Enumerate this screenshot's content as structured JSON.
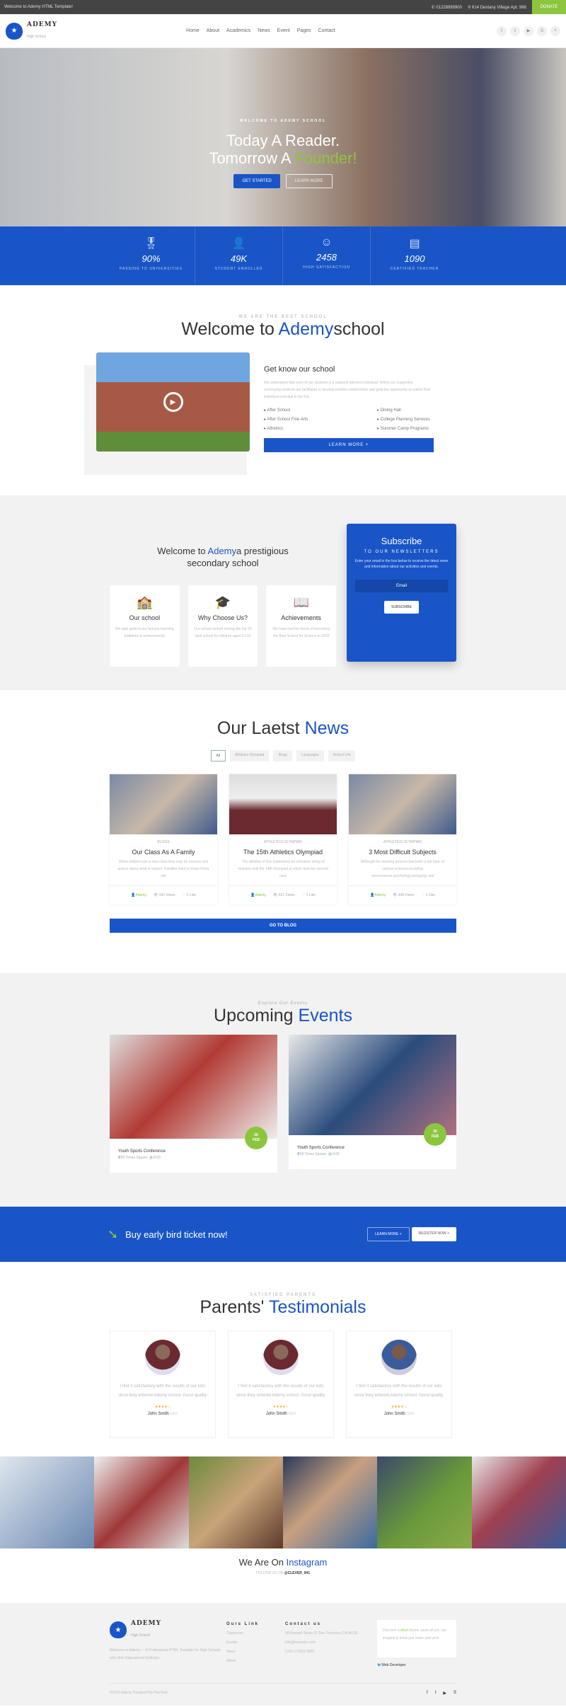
{
  "colors": {
    "primary": "#1a55c7",
    "accent": "#8cc63f",
    "topbar": "#444444"
  },
  "topbar": {
    "welcome": "Welcome to Ademy HTML Template!",
    "phone": "01228899900",
    "address": "614 Destany Village Apt. 968",
    "donate": "DONATE"
  },
  "header": {
    "brand": "ADEMY",
    "tagline": "High School",
    "nav": [
      "Home",
      "About",
      "Academics",
      "News",
      "Event",
      "Pages",
      "Contact"
    ],
    "socials": [
      "facebook-icon",
      "twitter-icon",
      "youtube-icon",
      "skype-icon",
      "search-icon"
    ]
  },
  "hero": {
    "kicker": "WELCOME TO ADEMY SCHOOL",
    "line1": "Today A Reader.",
    "line2": "Tomorrow A ",
    "highlight": "Founder!",
    "get_started": "GET STARTED",
    "learn_more": "LEARN MORE"
  },
  "stats": [
    {
      "icon": "award-icon",
      "value": "90%",
      "label": "PASSING TO UNIVERSITIES"
    },
    {
      "icon": "user-icon",
      "value": "49K",
      "label": "STUDENT ENROLLED"
    },
    {
      "icon": "smile-icon",
      "value": "2458",
      "label": "HIGH SATISFACTION"
    },
    {
      "icon": "id-card-icon",
      "value": "1090",
      "label": "CERTIFIED TEACHER"
    }
  ],
  "welcome": {
    "kicker": "WE ARE THE BEST SCHOOL",
    "title": "Welcome to ",
    "brand": "Ademy",
    "title_end": "school",
    "subtitle": "Get know our school",
    "text": "We understand that each of our students is a uniquely talented individual. Within our supportive community,students are facilitated to develop positive relationships and grab the opportunity to realize their individual potential to the full.",
    "list": [
      "After School",
      "Dining Hall",
      "After School Fine Arts",
      "College Planning Services",
      "Athletics",
      "Summer Camp Programs"
    ],
    "button": "LEARN MORE +"
  },
  "about": {
    "title_pre": "Welcome to ",
    "brand": "Ademy",
    "title_post": "a prestigious",
    "title_line2": "secondary school",
    "cards": [
      {
        "icon": "school-building-icon",
        "title": "Our school",
        "text": "We take pride in our famous teaching traditions & achievements"
      },
      {
        "icon": "graduation-cap-icon",
        "title": "Why Choose Us?",
        "text": "Our school ranked among the top 10 best school for children aged 13-19"
      },
      {
        "icon": "book-icon",
        "title": "Achievements",
        "text": "We have had the honor of becoming the Best School for Science in 2020"
      }
    ],
    "subscribe": {
      "title": "Subscribe",
      "kicker": "TO OUR NEWSLETTERS",
      "text": "Enter your email in the box below to receive the latest news and information about our activities and events.",
      "placeholder": "Email",
      "button": "SUBSCRIBE"
    }
  },
  "news": {
    "title": "Our Laetst ",
    "highlight": "News",
    "filters": [
      "All",
      "Athletics Olympiad",
      "Blogs",
      "Languages",
      "School Life"
    ],
    "items": [
      {
        "cat": "BLOGS",
        "title": "Our Class As A Family",
        "text": "When children join a new class,they may be nervous and unsure about what to expect. Families want to know if they will",
        "author": "Ademy",
        "views": "342 Views",
        "likes": "0 Like"
      },
      {
        "cat": "ATHLETICS OLYMPIAD",
        "title": "The 15th Athletics Olympiad",
        "text": "The athletes of Elis maintained an unbroken string of victories until the 14th Olympiad,at which time the second race",
        "author": "Ademy",
        "views": "321 Views",
        "likes": "2 Like"
      },
      {
        "cat": "ATHLETICS OLYMPIAD",
        "title": "3 Most Difficult Subjects",
        "text": "Although the learning process has been a hot topic of various sciences,including neuroscience,psychology,pedagogy and",
        "author": "Ademy",
        "views": "308 Views",
        "likes": "1 Like"
      }
    ],
    "button": "GO TO BLOG"
  },
  "events": {
    "kicker": "Explore Our Events",
    "title": "Upcoming ",
    "highlight": "Events",
    "items": [
      {
        "day": "26",
        "month": "FEB",
        "title": "Youth Sports Conference",
        "place": "30 Times Square",
        "time": "8:00"
      },
      {
        "day": "26",
        "month": "FEB",
        "title": "Youth Sports Conference",
        "place": "30 Times Square",
        "time": "8:00"
      }
    ]
  },
  "banner": {
    "text": "Buy early bird ticket now!",
    "learn": "LEARN MORE +",
    "register": "REGISTER NOW +"
  },
  "testimonials": {
    "kicker": "SATISFIED PARENTS",
    "title": "Parents' ",
    "highlight": "Testimonials",
    "items": [
      {
        "text": "I find it satisfactory with the results of our kids since they entered Ademy school. Good quality.",
        "rating": 4,
        "stars": "★★★★☆",
        "name": "John Smith",
        "role": "CEO"
      },
      {
        "text": "I find it satisfactory with the results of our kids since they entered Ademy school. Good quality.",
        "rating": 4,
        "stars": "★★★★☆",
        "name": "John Smith",
        "role": "CEO"
      },
      {
        "text": "I find it satisfactory with the results of our kids since they entered Ademy school. Good quality.",
        "rating": 4,
        "stars": "★★★★☆",
        "name": "John Smith",
        "role": "CEO"
      }
    ]
  },
  "instagram": {
    "title": "We Are On ",
    "highlight": "Instagram",
    "follow": "FOLLOW US ON ",
    "handle": "@CLEVER_941"
  },
  "footer": {
    "brand": "ADEMY",
    "tagline": "High School",
    "about": "Welcome to Ademy — A Professional HTML Template for High Schools and other Educational Institutes",
    "links_title": "Ours Link",
    "links": [
      "Classroom",
      "Events",
      "News",
      "About"
    ],
    "contact_title": "Contact us",
    "contact": [
      "58 Howard Street #2 San Francisco,CA 94105",
      "info@example.com",
      "(+61) 2-2331 5820"
    ],
    "tweet_pre": "Discover a ",
    "tweet_link": "short",
    "tweet_post": " theme oasis all you can imagine & more just make your pick",
    "tweet_author": "Web Developer",
    "copyright": "©2020 Ademy Designed By HasTech",
    "socials": [
      "facebook-icon",
      "twitter-icon",
      "youtube-icon",
      "skype-icon"
    ]
  }
}
